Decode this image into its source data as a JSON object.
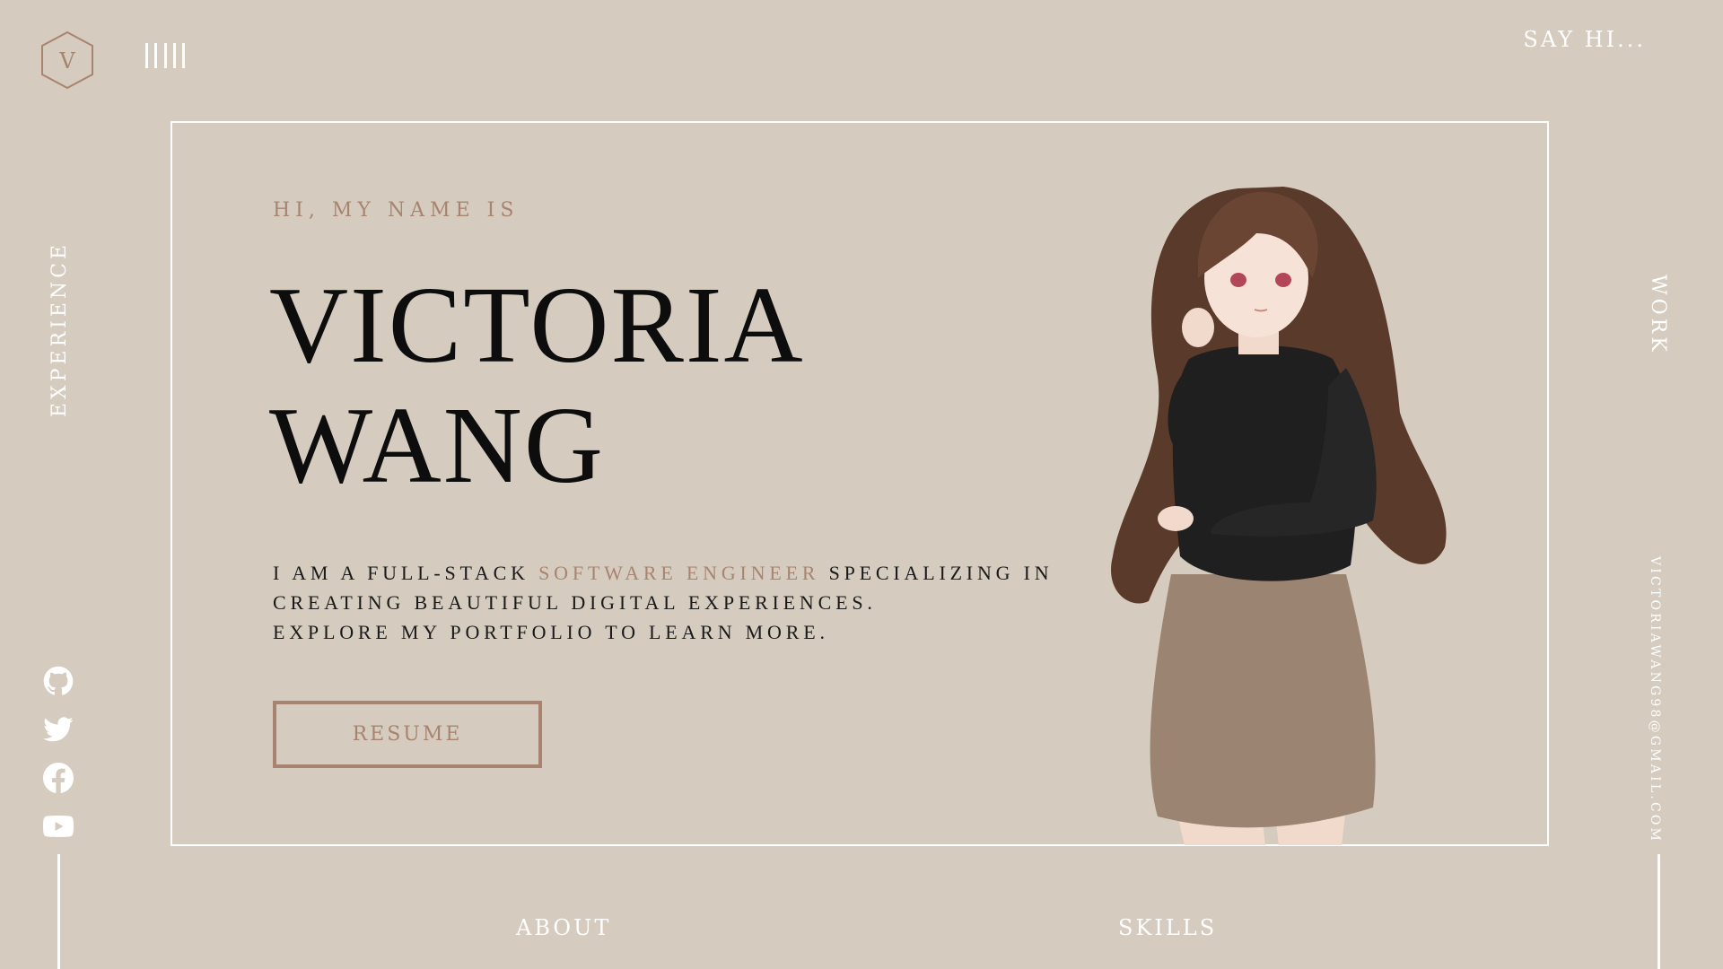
{
  "colors": {
    "background": "#d5cbbf",
    "accent": "#a88470",
    "text_dark": "#0d0d0d",
    "text_light": "#ffffff"
  },
  "header": {
    "logo_letter": "V",
    "menu_icon": "menu-bars-icon",
    "say_hi_label": "SAY HI..."
  },
  "side": {
    "left_label": "EXPERIENCE",
    "right_label": "WORK",
    "email": "VICTORIAWANG98@GMAIL.COM"
  },
  "socials": [
    {
      "icon": "github-icon"
    },
    {
      "icon": "twitter-icon"
    },
    {
      "icon": "facebook-icon"
    },
    {
      "icon": "youtube-icon"
    }
  ],
  "hero": {
    "greeting": "HI, MY NAME IS",
    "first_name": "VICTORIA",
    "last_name": "WANG",
    "desc_part1": "I AM A FULL-STACK ",
    "desc_highlight": "SOFTWARE ENGINEER",
    "desc_part2": " SPECIALIZING IN",
    "desc_line2": "CREATING BEAUTIFUL DIGITAL EXPERIENCES.",
    "desc_line3": "EXPLORE MY PORTFOLIO TO LEARN MORE.",
    "resume_label": "RESUME",
    "illustration": "anime-character-illustration"
  },
  "nav": {
    "about_label": "ABOUT",
    "skills_label": "SKILLS"
  }
}
